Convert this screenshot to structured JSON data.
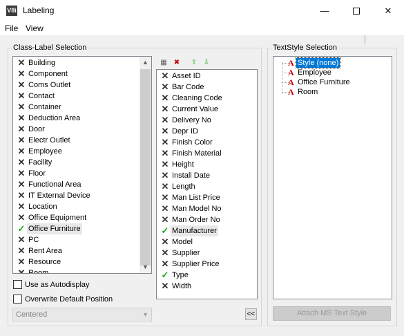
{
  "window": {
    "icon_text": "V8i",
    "title": "Labeling",
    "minimize": "—",
    "close": "✕"
  },
  "menu": [
    "File",
    "View"
  ],
  "class_label": {
    "group_title": "Class-Label Selection",
    "classes": [
      {
        "label": "Building",
        "state": "x"
      },
      {
        "label": "Component",
        "state": "x"
      },
      {
        "label": "Coms Outlet",
        "state": "x"
      },
      {
        "label": "Contact",
        "state": "x"
      },
      {
        "label": "Container",
        "state": "x"
      },
      {
        "label": "Deduction Area",
        "state": "x"
      },
      {
        "label": "Door",
        "state": "x"
      },
      {
        "label": "Electr Outlet",
        "state": "x"
      },
      {
        "label": "Employee",
        "state": "x"
      },
      {
        "label": "Facility",
        "state": "x"
      },
      {
        "label": "Floor",
        "state": "x"
      },
      {
        "label": "Functional Area",
        "state": "x"
      },
      {
        "label": "IT External Device",
        "state": "x"
      },
      {
        "label": "Location",
        "state": "x"
      },
      {
        "label": "Office Equipment",
        "state": "x"
      },
      {
        "label": "Office Furniture",
        "state": "check",
        "selected": true
      },
      {
        "label": "PC",
        "state": "x"
      },
      {
        "label": "Rent Area",
        "state": "x"
      },
      {
        "label": "Resource",
        "state": "x"
      },
      {
        "label": "Room",
        "state": "x"
      }
    ],
    "labels": [
      {
        "label": "Asset ID",
        "state": "x"
      },
      {
        "label": "Bar Code",
        "state": "x"
      },
      {
        "label": "Cleaning Code",
        "state": "x"
      },
      {
        "label": "Current Value",
        "state": "x"
      },
      {
        "label": "Delivery No",
        "state": "x"
      },
      {
        "label": "Depr ID",
        "state": "x"
      },
      {
        "label": "Finish Color",
        "state": "x"
      },
      {
        "label": "Finish Material",
        "state": "x"
      },
      {
        "label": "Height",
        "state": "x"
      },
      {
        "label": "Install Date",
        "state": "x"
      },
      {
        "label": "Length",
        "state": "x"
      },
      {
        "label": "Man List Price",
        "state": "x"
      },
      {
        "label": "Man Model No",
        "state": "x"
      },
      {
        "label": "Man Order No",
        "state": "x"
      },
      {
        "label": "Manufacturer",
        "state": "check",
        "selected": true
      },
      {
        "label": "Model",
        "state": "x"
      },
      {
        "label": "Supplier",
        "state": "x"
      },
      {
        "label": "Supplier Price",
        "state": "x"
      },
      {
        "label": "Type",
        "state": "check"
      },
      {
        "label": "Width",
        "state": "x"
      }
    ],
    "use_autodisplay": "Use as Autodisplay",
    "overwrite_default": "Overwrite Default Position",
    "position_value": "Centered",
    "move_left_button": "<<"
  },
  "textstyle": {
    "group_title": "TextStyle Selection",
    "styles": [
      {
        "label": "Style (none)",
        "selected": true
      },
      {
        "label": "Employee"
      },
      {
        "label": "Office Furniture"
      },
      {
        "label": "Room"
      }
    ],
    "attach_button": "Attach MS Text Style"
  },
  "colors": {
    "check": "#22aa22",
    "selection": "#0078d7",
    "textstyle_icon": "#c00000"
  }
}
